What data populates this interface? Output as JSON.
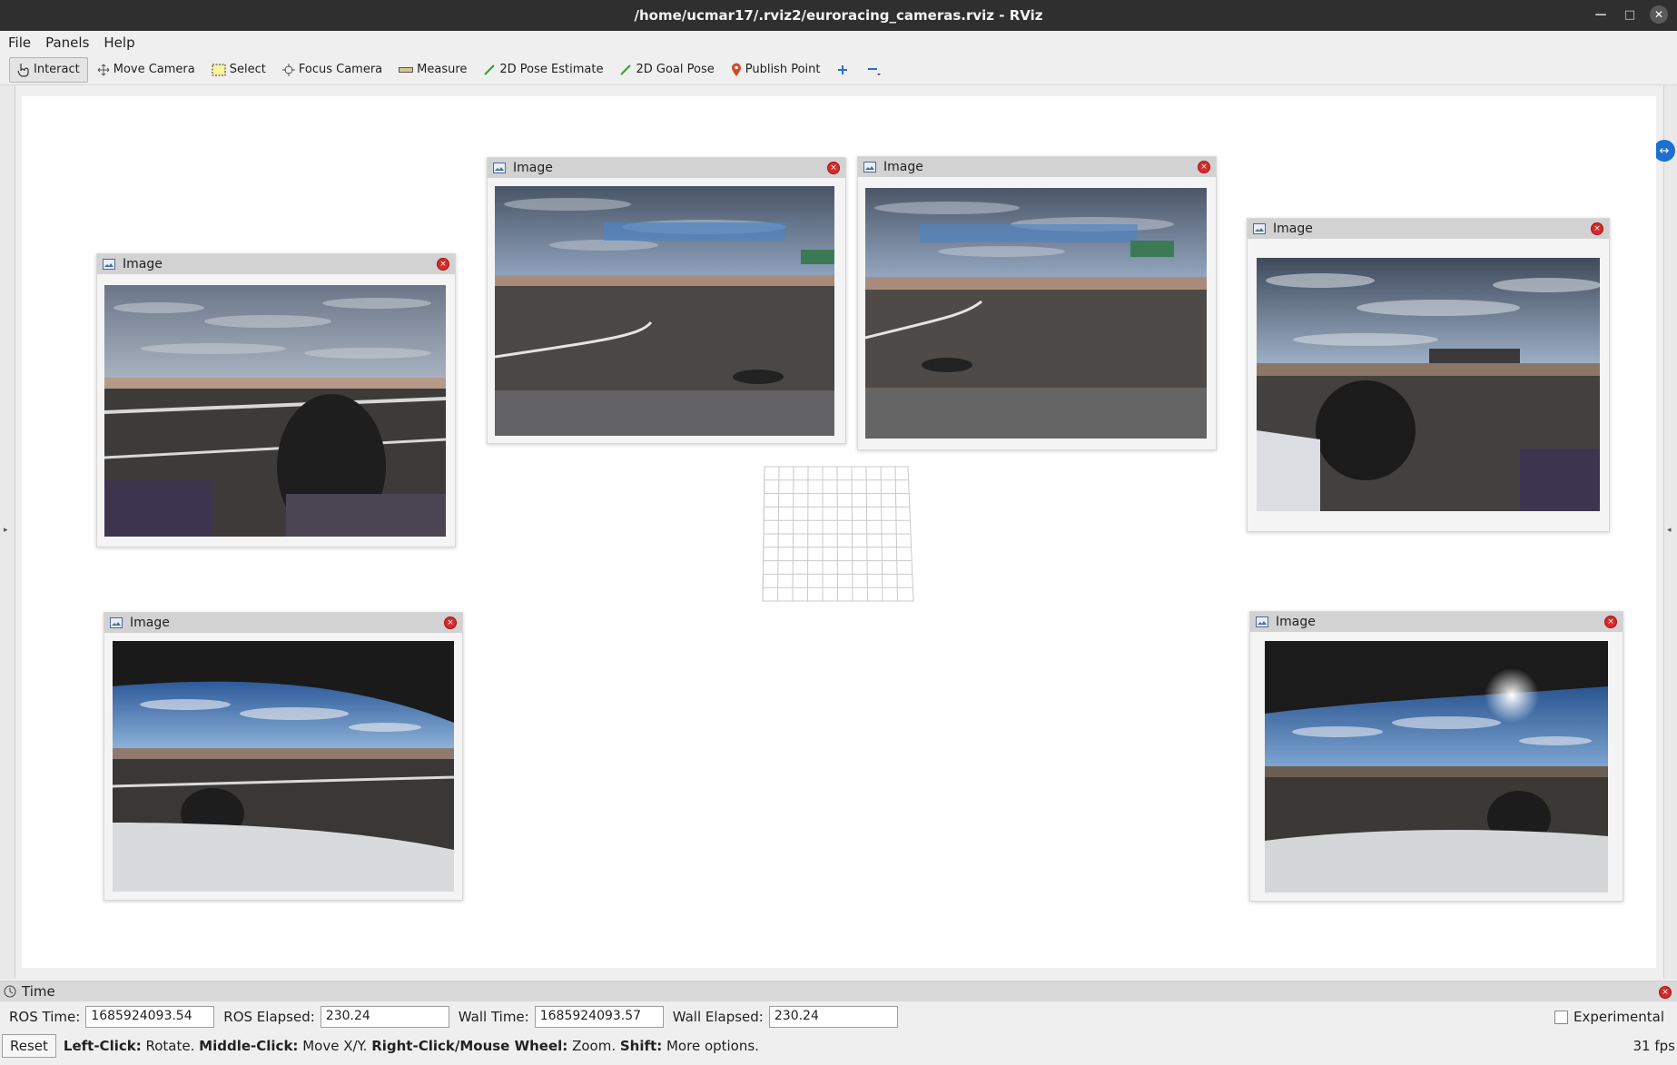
{
  "window": {
    "title": "/home/ucmar17/.rviz2/euroracing_cameras.rviz - RViz"
  },
  "menu": {
    "file": "File",
    "panels": "Panels",
    "help": "Help"
  },
  "toolbar": {
    "interact": "Interact",
    "move_camera": "Move Camera",
    "select": "Select",
    "focus_camera": "Focus Camera",
    "measure": "Measure",
    "pose_estimate": "2D Pose Estimate",
    "goal_pose": "2D Goal Pose",
    "publish_point": "Publish Point"
  },
  "panels": {
    "p1": {
      "title": "Image"
    },
    "p2": {
      "title": "Image"
    },
    "p3": {
      "title": "Image"
    },
    "p4": {
      "title": "Image"
    },
    "p5": {
      "title": "Image"
    },
    "p6": {
      "title": "Image"
    }
  },
  "time": {
    "header": "Time",
    "ros_time_label": "ROS Time:",
    "ros_time": "1685924093.54",
    "ros_elapsed_label": "ROS Elapsed:",
    "ros_elapsed": "230.24",
    "wall_time_label": "Wall Time:",
    "wall_time": "1685924093.57",
    "wall_elapsed_label": "Wall Elapsed:",
    "wall_elapsed": "230.24",
    "experimental": "Experimental"
  },
  "status": {
    "reset": "Reset",
    "left_click_key": "Left-Click:",
    "left_click_val": "Rotate.",
    "middle_click_key": "Middle-Click:",
    "middle_click_val": "Move X/Y.",
    "right_click_key": "Right-Click/Mouse Wheel:",
    "right_click_val": "Zoom.",
    "shift_key": "Shift:",
    "shift_val": "More options.",
    "fps": "31 fps"
  },
  "icons": {
    "image_panel": "image-icon",
    "close": "close-icon",
    "clock": "clock-icon"
  }
}
